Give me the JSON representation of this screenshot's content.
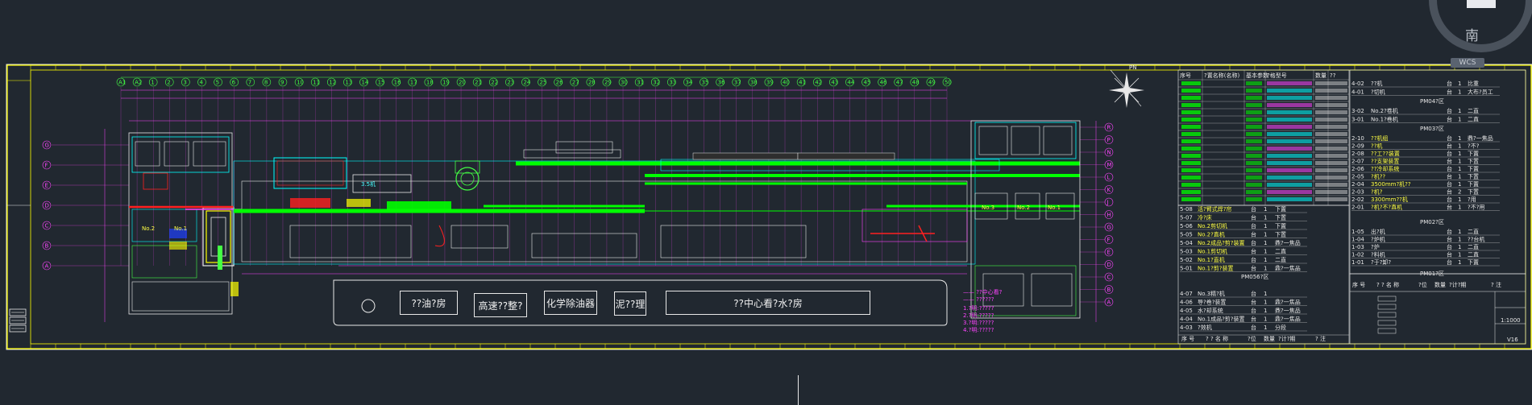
{
  "viewcube": {
    "direction_label": "南",
    "wcs_label": "WCS"
  },
  "north_label": "PN",
  "buildings": [
    {
      "id": "b1",
      "label": "??油?房"
    },
    {
      "id": "b2",
      "label": "高速??整?"
    },
    {
      "id": "b3",
      "label": "化学除油器"
    },
    {
      "id": "b4",
      "label": "泥??理"
    },
    {
      "id": "b5",
      "label": "??中心看?水?房"
    }
  ],
  "plan_labels": {
    "left_equipment_1": "No.2",
    "left_equipment_2": "No.1",
    "right_equipment_1": "No.3",
    "right_equipment_2": "No.2",
    "right_equipment_3": "No.1",
    "mid_label": "3.5机"
  },
  "table_left": {
    "rows": [
      [
        "5-08",
        "活?臂式焊?帘",
        "台",
        "1",
        "下置"
      ],
      [
        "5-07",
        "冷?床",
        "台",
        "1",
        "下置"
      ],
      [
        "5-06",
        "No.2剪切机",
        "台",
        "1",
        "下置"
      ],
      [
        "5-05",
        "No.2?直机",
        "台",
        "1",
        "下置"
      ],
      [
        "5-04",
        "No.2成品?剪?装置",
        "台",
        "1",
        "鼎?一焦品"
      ],
      [
        "5-03",
        "No.1剪切机",
        "台",
        "1",
        "二直"
      ],
      [
        "5-02",
        "No.1?直机",
        "台",
        "1",
        "二直"
      ],
      [
        "5-01",
        "No.1?剪?装置",
        "台",
        "1",
        "鼎?一焦品"
      ]
    ],
    "bottom_section": "PM056?区",
    "bottom_rows": [
      [
        "4-07",
        "No.3精?机",
        "台",
        "1",
        ""
      ],
      [
        "4-06",
        "导?卷?装置",
        "台",
        "1",
        "鼎?一焦品"
      ],
      [
        "4-05",
        "水?却系统",
        "台",
        "1",
        "鼎?一焦品"
      ],
      [
        "4-04",
        "No.1成品?剪?装置",
        "台",
        "1",
        "鼎?一焦品"
      ],
      [
        "4-03",
        "?效机",
        "台",
        "1",
        "分段"
      ]
    ],
    "footer": [
      "序 号",
      "? ? 名 称",
      "?位",
      "数量",
      "?计?期",
      "? 注"
    ]
  },
  "table_right": {
    "top_rows": [
      [
        "4-02",
        "??机",
        "台",
        "1",
        "比重"
      ],
      [
        "4-01",
        "?切机",
        "台",
        "1",
        "大布?员工"
      ]
    ],
    "section_1": "PM04?区",
    "mid_rows": [
      [
        "3-02",
        "No.2?卷机",
        "台",
        "1",
        "二直"
      ],
      [
        "3-01",
        "No.1?卷机",
        "台",
        "1",
        "二直"
      ]
    ],
    "section_2": "PM03?区",
    "rows": [
      [
        "2-10",
        "??机组",
        "台",
        "1",
        "鼎?一焦品"
      ],
      [
        "2-09",
        "??机",
        "台",
        "1",
        "?不?"
      ],
      [
        "2-08",
        "??工??装置",
        "台",
        "1",
        "下置"
      ],
      [
        "2-07",
        "??支架装置",
        "台",
        "1",
        "下置"
      ],
      [
        "2-06",
        "??冷却系统",
        "台",
        "1",
        "下置"
      ],
      [
        "2-05",
        "?机??",
        "台",
        "1",
        "下置"
      ],
      [
        "2-04",
        "3500mm?机??",
        "台",
        "1",
        "下置"
      ],
      [
        "2-03",
        "?机?",
        "台",
        "2",
        "下置"
      ],
      [
        "2-02",
        "3300mm??机",
        "台",
        "1",
        "?用"
      ],
      [
        "2-01",
        "?机?不?直机",
        "台",
        "1",
        "?不?用"
      ]
    ],
    "section_3": "PM02?区",
    "rows_2": [
      [
        "1-05",
        "出?机",
        "台",
        "1",
        "二直"
      ],
      [
        "1-04",
        "?炉机",
        "台",
        "1",
        "??台机"
      ],
      [
        "1-03",
        "?炉",
        "台",
        "1",
        "二直"
      ],
      [
        "1-02",
        "?料机",
        "台",
        "1",
        "二直"
      ],
      [
        "1-01",
        "?于?卸?",
        "台",
        "1",
        "下置"
      ]
    ],
    "section_4": "PM01?区",
    "footer": [
      "序 号",
      "? ? 名 称",
      "?位",
      "数量",
      "?计?期",
      "? 注"
    ]
  },
  "title_block": {
    "scale": "1:1000",
    "sheet": "V16"
  },
  "axis_numbers_top": [
    "A1",
    "A2",
    "1",
    "2",
    "3",
    "4",
    "5",
    "6",
    "7",
    "8",
    "9",
    "10",
    "11",
    "12",
    "13",
    "14",
    "15",
    "16",
    "17",
    "18",
    "19",
    "20",
    "21",
    "22",
    "23",
    "24",
    "25",
    "26",
    "27",
    "28",
    "29",
    "30",
    "31",
    "32",
    "33",
    "34",
    "35",
    "36",
    "37",
    "38",
    "39",
    "40",
    "41",
    "42",
    "43",
    "44",
    "45",
    "46",
    "47",
    "48",
    "49",
    "50"
  ],
  "axis_letters_left": [
    "G",
    "F",
    "E",
    "D",
    "C",
    "B",
    "A"
  ],
  "axis_letters_right": [
    "R",
    "P",
    "N",
    "M",
    "L",
    "K",
    "J",
    "H",
    "G",
    "F",
    "E",
    "D",
    "C",
    "B",
    "A"
  ],
  "equipment_list_header": [
    "序号",
    "?置名称(名称)",
    "基本参数",
    "?格型号",
    "数量",
    "??"
  ],
  "legend_notes": [
    "1.?明:?????",
    "2.?明:?????",
    "3.?明:?????",
    "4.?明:?????"
  ],
  "legend_text": [
    "—— ??中心看?",
    "—— ??????"
  ],
  "colors": {
    "background": "#212830",
    "frame": "#ffff00",
    "green": "#00ff00",
    "cyan": "#00ffff",
    "magenta": "#ff00ff",
    "red": "#ff2020",
    "white": "#e8e8e8"
  }
}
